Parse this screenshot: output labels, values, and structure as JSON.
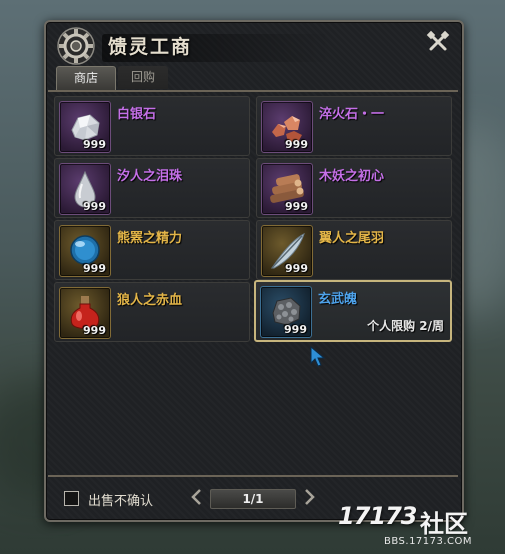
{
  "window": {
    "title": "馈灵工商",
    "tabs": [
      {
        "label": "商店",
        "active": true
      },
      {
        "label": "回购",
        "active": false
      }
    ]
  },
  "items": [
    {
      "name": "白银石",
      "count": "999",
      "icon": "silver-ore-icon",
      "rarity": "purple"
    },
    {
      "name": "淬火石・一",
      "count": "999",
      "icon": "copper-ore-icon",
      "rarity": "purple"
    },
    {
      "name": "汐人之泪珠",
      "count": "999",
      "icon": "teardrop-icon",
      "rarity": "purple"
    },
    {
      "name": "木妖之初心",
      "count": "999",
      "icon": "wood-logs-icon",
      "rarity": "purple"
    },
    {
      "name": "熊罴之精力",
      "count": "999",
      "icon": "blue-orb-icon",
      "rarity": "gold"
    },
    {
      "name": "翼人之尾羽",
      "count": "999",
      "icon": "feather-icon",
      "rarity": "gold"
    },
    {
      "name": "狼人之赤血",
      "count": "999",
      "icon": "red-potion-icon",
      "rarity": "gold"
    },
    {
      "name": "玄武魄",
      "count": "999",
      "icon": "tortoise-stone-icon",
      "rarity": "blue",
      "limit": "个人限购 2/周",
      "selected": true
    }
  ],
  "footer": {
    "checkbox_label": "出售不确认",
    "checked": false,
    "page": "1/1"
  },
  "watermark": {
    "logo": "17173",
    "name": "社区",
    "url": "BBS.17173.COM"
  },
  "colors": {
    "purple_name": "#c46fe7",
    "gold_name": "#e3b548",
    "blue_name": "#4ea2ea",
    "panel_bg": "#1f2124",
    "border": "#6d6a62"
  }
}
